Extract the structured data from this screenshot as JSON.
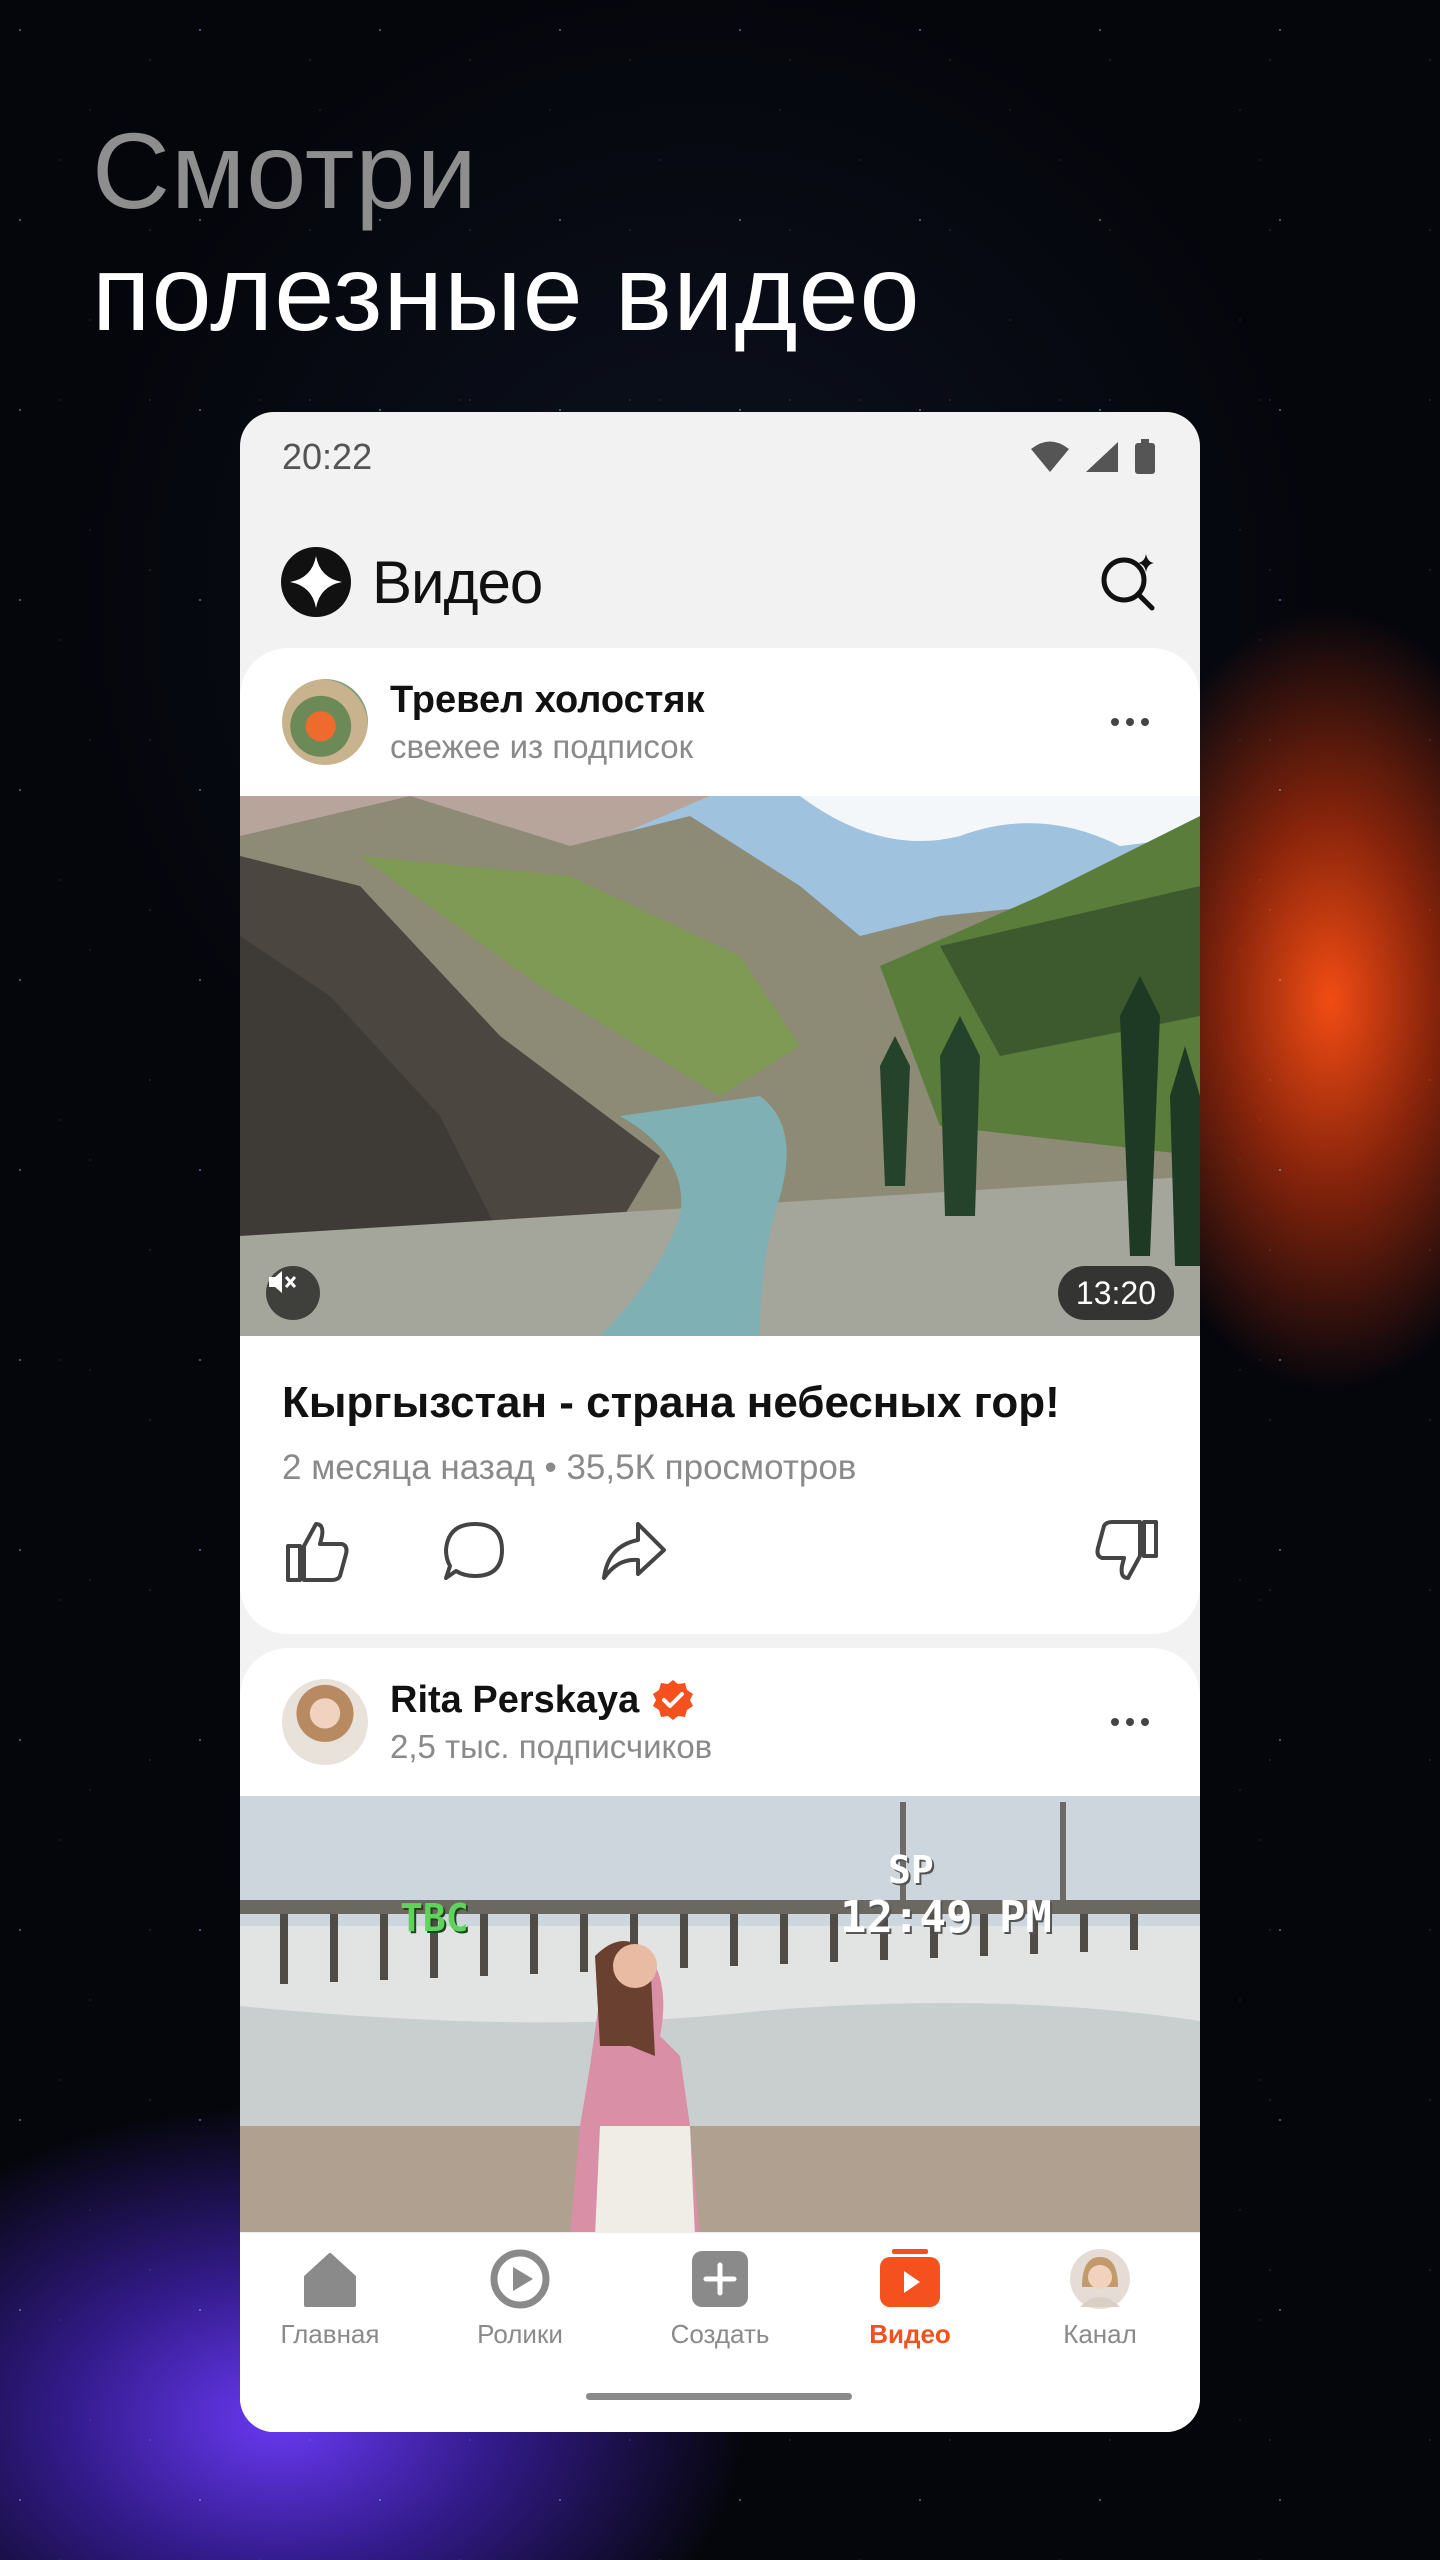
{
  "headline": {
    "line1": "Смотри",
    "line2": "полезные видео"
  },
  "status_bar": {
    "time": "20:22",
    "icons": [
      "wifi-icon",
      "signal-icon",
      "battery-icon"
    ]
  },
  "app_bar": {
    "title": "Видео",
    "logo_icon": "sparkle-logo-icon",
    "search_icon": "sparkle-search-icon"
  },
  "feed": [
    {
      "channel_name": "Тревел холостяк",
      "channel_subtitle": "свежее из подписок",
      "duration": "13:20",
      "title": "Кыргызстан - страна небесных гор!",
      "meta": "2 месяца назад • 35,5К просмотров"
    },
    {
      "channel_name": "Rita Perskaya",
      "channel_subtitle": "2,5 тыс. подписчиков",
      "verified": true,
      "overlay_tbc": "TBC",
      "overlay_sp": "SP",
      "overlay_time": "12:49 PM"
    }
  ],
  "bottom_nav": {
    "items": [
      {
        "label": "Главная",
        "icon": "home-icon",
        "active": false
      },
      {
        "label": "Ролики",
        "icon": "shorts-play-icon",
        "active": false
      },
      {
        "label": "Создать",
        "icon": "plus-icon",
        "active": false
      },
      {
        "label": "Видео",
        "icon": "video-icon",
        "active": true
      },
      {
        "label": "Канал",
        "icon": "channel-avatar",
        "active": false
      }
    ]
  },
  "colors": {
    "accent": "#f4511e",
    "verified": "#f4511e",
    "card_bg": "#ffffff",
    "screen_bg": "#f2f2f2"
  }
}
